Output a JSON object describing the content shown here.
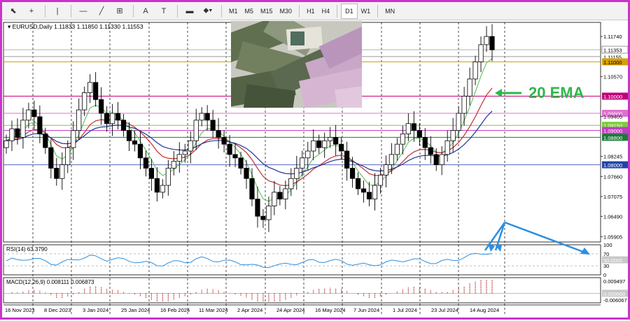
{
  "toolbar": {
    "tools": [
      {
        "name": "cursor-tool-button",
        "icon": "cursor-icon",
        "glyph": "⬉"
      },
      {
        "name": "crosshair-tool-button",
        "icon": "crosshair-icon",
        "glyph": "+"
      },
      {
        "name": "vertical-line-tool-button",
        "icon": "vertical-line-icon",
        "glyph": "|"
      },
      {
        "name": "horizontal-line-tool-button",
        "icon": "horizontal-line-icon",
        "glyph": "—"
      },
      {
        "name": "trendline-tool-button",
        "icon": "trendline-icon",
        "glyph": "╱"
      },
      {
        "name": "fibonacci-tool-button",
        "icon": "fibonacci-icon",
        "glyph": "⊞"
      },
      {
        "name": "text-tool-button",
        "icon": "text-icon",
        "glyph": "A"
      },
      {
        "name": "text-label-tool-button",
        "icon": "text-label-icon",
        "glyph": "T"
      },
      {
        "name": "rectangle-label-tool-button",
        "icon": "label-icon",
        "glyph": "▬"
      },
      {
        "name": "shapes-tool-button",
        "icon": "shapes-icon",
        "glyph": "⬥▾"
      }
    ],
    "timeframes": [
      "M1",
      "M5",
      "M15",
      "M30",
      "H1",
      "H4",
      "D1",
      "W1",
      "MN"
    ],
    "active_timeframe": "D1"
  },
  "header": {
    "symbol_line": "EURUSD,Daily  1.11833 1.11850 1.11330 1.11553"
  },
  "annotation": {
    "label": "20 EMA",
    "color": "#2db84a",
    "arrow_color": "#2d8fe0"
  },
  "price_axis": {
    "ticks": [
      "1.11740",
      "1.10570",
      "1.09405",
      "1.08245",
      "1.07660",
      "1.07075",
      "1.06490",
      "1.05905"
    ],
    "current_price": "1.11353",
    "price_box_color": "#9a9a9a",
    "levels": [
      {
        "label": "1.11155",
        "color": "#ffffff",
        "text_color": "#000000",
        "line": "#9a9a9a"
      },
      {
        "label": "1.11000",
        "color": "#d4a000",
        "text_color": "#000000",
        "line": "#c9a100"
      },
      {
        "label": "1.10000",
        "color": "#c2007a",
        "text_color": "#ffffff",
        "line": "#c2007a"
      },
      {
        "label": "1.09500",
        "color": "#e070d0",
        "text_color": "#ffffff",
        "line": "#e070d0"
      },
      {
        "label": "1.09150",
        "color": "#7ccc3a",
        "text_color": "#ffffff",
        "line": "#7ccc3a"
      },
      {
        "label": "1.09000",
        "color": "#c040c0",
        "text_color": "#ffffff",
        "line": "#c040c0"
      },
      {
        "label": "1.08800",
        "color": "#1d7a3a",
        "text_color": "#ffffff",
        "line": "#1d7a3a"
      },
      {
        "label": "1.08000",
        "color": "#2244aa",
        "text_color": "#ffffff",
        "line": "#5566bb"
      }
    ]
  },
  "rsi": {
    "label": "RSI(14) 63.3790",
    "ticks": [
      "100",
      "70",
      "30",
      "0"
    ],
    "level_box": "50.0000"
  },
  "macd": {
    "label": "MACD(12,26,9) 0.008111 0.006873",
    "ticks": [
      "0.009497",
      "-0.006067"
    ],
    "level_box": "0.000000"
  },
  "time_axis": {
    "labels": [
      "16 Nov 2023",
      "8 Dec 2023",
      "3 Jan 2024",
      "25 Jan 2024",
      "16 Feb 2024",
      "11 Mar 2024",
      "2 Apr 2024",
      "24 Apr 2024",
      "16 May 2024",
      "7 Jun 2024",
      "1 Jul 2024",
      "23 Jul 2024",
      "14 Aug 2024"
    ]
  },
  "chart_data": {
    "type": "candlestick",
    "symbol": "EURUSD",
    "timeframe": "Daily",
    "last_bar": {
      "open": 1.11833,
      "high": 1.1185,
      "low": 1.1133,
      "close": 1.11553
    },
    "series_closes": [
      1.087,
      1.0905,
      1.088,
      1.093,
      1.096,
      1.094,
      1.089,
      1.085,
      1.079,
      1.076,
      1.08,
      1.085,
      1.09,
      1.096,
      1.101,
      1.104,
      1.099,
      1.095,
      1.092,
      1.095,
      1.093,
      1.09,
      1.087,
      1.086,
      1.082,
      1.079,
      1.076,
      1.072,
      1.074,
      1.079,
      1.081,
      1.083,
      1.084,
      1.087,
      1.093,
      1.095,
      1.093,
      1.09,
      1.088,
      1.086,
      1.083,
      1.082,
      1.079,
      1.076,
      1.07,
      1.065,
      1.064,
      1.068,
      1.072,
      1.07,
      1.073,
      1.076,
      1.079,
      1.082,
      1.084,
      1.087,
      1.085,
      1.087,
      1.088,
      1.086,
      1.084,
      1.079,
      1.076,
      1.073,
      1.072,
      1.07,
      1.074,
      1.077,
      1.08,
      1.083,
      1.086,
      1.089,
      1.092,
      1.09,
      1.088,
      1.085,
      1.083,
      1.08,
      1.083,
      1.087,
      1.09,
      1.095,
      1.1,
      1.105,
      1.11,
      1.115,
      1.1174,
      1.1135
    ]
  }
}
